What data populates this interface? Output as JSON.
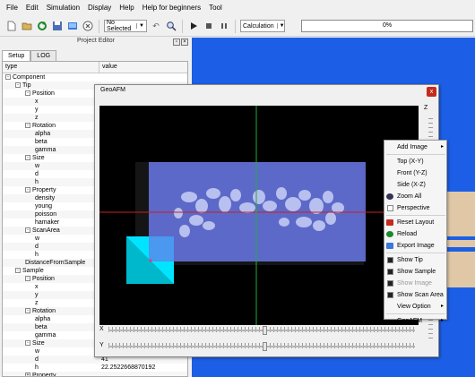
{
  "menubar": {
    "items": [
      "File",
      "Edit",
      "Simulation",
      "Display",
      "Help",
      "Help for beginners",
      "Tool"
    ]
  },
  "toolbar": {
    "selection": "No Selected",
    "mode": "Calculation",
    "progress": "0%"
  },
  "panel": {
    "title": "Project Editor",
    "tabs": [
      "Setup",
      "LOG"
    ],
    "columns": [
      "type",
      "value"
    ],
    "rows": [
      {
        "label": "Component",
        "indent": 0,
        "toggle": "-",
        "value": ""
      },
      {
        "label": "Tip",
        "indent": 1,
        "toggle": "-",
        "value": ""
      },
      {
        "label": "Position",
        "indent": 2,
        "toggle": "-",
        "value": ""
      },
      {
        "label": "x",
        "indent": 3,
        "toggle": "",
        "value": ""
      },
      {
        "label": "y",
        "indent": 3,
        "toggle": "",
        "value": ""
      },
      {
        "label": "z",
        "indent": 3,
        "toggle": "",
        "value": ""
      },
      {
        "label": "Rotation",
        "indent": 2,
        "toggle": "-",
        "value": ""
      },
      {
        "label": "alpha",
        "indent": 3,
        "toggle": "",
        "value": ""
      },
      {
        "label": "beta",
        "indent": 3,
        "toggle": "",
        "value": ""
      },
      {
        "label": "gamma",
        "indent": 3,
        "toggle": "",
        "value": ""
      },
      {
        "label": "Size",
        "indent": 2,
        "toggle": "-",
        "value": ""
      },
      {
        "label": "w",
        "indent": 3,
        "toggle": "",
        "value": ""
      },
      {
        "label": "d",
        "indent": 3,
        "toggle": "",
        "value": ""
      },
      {
        "label": "h",
        "indent": 3,
        "toggle": "",
        "value": ""
      },
      {
        "label": "Property",
        "indent": 2,
        "toggle": "-",
        "value": ""
      },
      {
        "label": "density",
        "indent": 3,
        "toggle": "",
        "value": ""
      },
      {
        "label": "young",
        "indent": 3,
        "toggle": "",
        "value": ""
      },
      {
        "label": "poisson",
        "indent": 3,
        "toggle": "",
        "value": ""
      },
      {
        "label": "hamaker",
        "indent": 3,
        "toggle": "",
        "value": ""
      },
      {
        "label": "ScanArea",
        "indent": 2,
        "toggle": "-",
        "value": ""
      },
      {
        "label": "w",
        "indent": 3,
        "toggle": "",
        "value": ""
      },
      {
        "label": "d",
        "indent": 3,
        "toggle": "",
        "value": ""
      },
      {
        "label": "h",
        "indent": 3,
        "toggle": "",
        "value": ""
      },
      {
        "label": "DistanceFromSample",
        "indent": 2,
        "toggle": "",
        "value": ""
      },
      {
        "label": "Sample",
        "indent": 1,
        "toggle": "-",
        "value": ""
      },
      {
        "label": "Position",
        "indent": 2,
        "toggle": "-",
        "value": ""
      },
      {
        "label": "x",
        "indent": 3,
        "toggle": "",
        "value": ""
      },
      {
        "label": "y",
        "indent": 3,
        "toggle": "",
        "value": ""
      },
      {
        "label": "z",
        "indent": 3,
        "toggle": "",
        "value": ""
      },
      {
        "label": "Rotation",
        "indent": 2,
        "toggle": "-",
        "value": ""
      },
      {
        "label": "alpha",
        "indent": 3,
        "toggle": "",
        "value": ""
      },
      {
        "label": "beta",
        "indent": 3,
        "toggle": "",
        "value": ""
      },
      {
        "label": "gamma",
        "indent": 3,
        "toggle": "",
        "value": ""
      },
      {
        "label": "Size",
        "indent": 2,
        "toggle": "-",
        "value": ""
      },
      {
        "label": "w",
        "indent": 3,
        "toggle": "",
        "value": ""
      },
      {
        "label": "d",
        "indent": 3,
        "toggle": "",
        "value": "41"
      },
      {
        "label": "h",
        "indent": 3,
        "toggle": "",
        "value": "22.2522668870192"
      },
      {
        "label": "Property",
        "indent": 2,
        "toggle": "+",
        "value": ""
      }
    ]
  },
  "dialog": {
    "title": "GeoAFM",
    "close": "x",
    "axis_z": "Z",
    "slider_x": "X",
    "slider_y": "Y",
    "slider_x_pos": 0.51,
    "slider_y_pos": 0.51
  },
  "context_menu": {
    "items": [
      {
        "label": "Add Image",
        "sub": "▸",
        "icon": "none",
        "type": "item"
      },
      {
        "type": "sep"
      },
      {
        "label": "Top (X-Y)",
        "icon": "none",
        "type": "item"
      },
      {
        "label": "Front (Y-Z)",
        "icon": "none",
        "type": "item"
      },
      {
        "label": "Side (X-Z)",
        "icon": "none",
        "type": "item"
      },
      {
        "label": "Zoom All",
        "icon": "zoom-icon",
        "type": "item"
      },
      {
        "label": "Perspective",
        "icon": "checkbox",
        "checked": false,
        "type": "item"
      },
      {
        "type": "sep"
      },
      {
        "label": "Reset Layout",
        "icon": "reset-layout-icon",
        "type": "item"
      },
      {
        "label": "Reload",
        "icon": "reload-icon",
        "type": "item"
      },
      {
        "label": "Export Image",
        "icon": "export-image-icon",
        "type": "item"
      },
      {
        "type": "sep"
      },
      {
        "label": "Show Tip",
        "icon": "checkbox",
        "checked": true,
        "type": "item"
      },
      {
        "label": "Show Sample",
        "icon": "checkbox",
        "checked": true,
        "type": "item"
      },
      {
        "label": "Show Image",
        "icon": "checkbox",
        "checked": true,
        "disabled": true,
        "type": "item"
      },
      {
        "label": "Show Scan Area",
        "icon": "checkbox",
        "checked": true,
        "type": "item"
      },
      {
        "label": "View Option",
        "sub": "▸",
        "icon": "none",
        "type": "item"
      },
      {
        "type": "sep"
      },
      {
        "label": "GeoAFM",
        "sub": "▸",
        "icon": "none",
        "type": "item"
      }
    ]
  },
  "colors": {
    "viewport_bg": "#1c5fe6",
    "scan_area": "#6a78e8",
    "tip": "#00e5ff",
    "axis_x": "#cc1f1f",
    "axis_y": "#1fae36"
  }
}
